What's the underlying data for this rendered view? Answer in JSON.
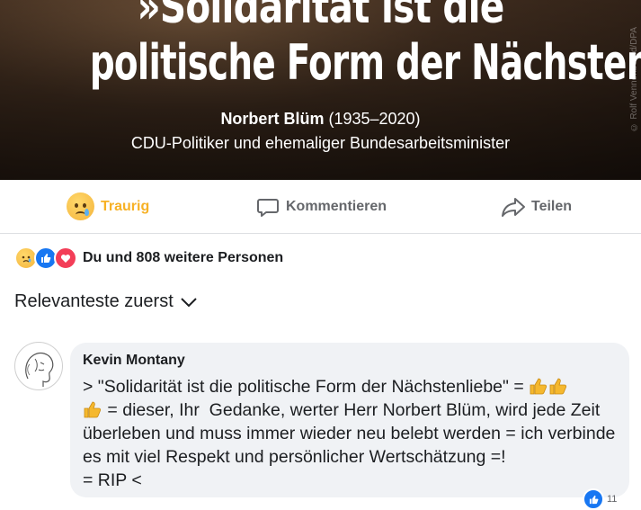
{
  "post_image": {
    "quote_line1": "»Solidarität ist die",
    "quote_line2": "politische Form der Nächstenliebe«",
    "author_name": "Norbert Blüm",
    "author_years": "(1935–2020)",
    "author_role": "CDU-Politiker und ehemaliger Bundesarbeitsminister",
    "watermark": "© Rolf Vennenbernd/DPA"
  },
  "actions": {
    "reaction_label": "Traurig",
    "comment_label": "Kommentieren",
    "share_label": "Teilen"
  },
  "reactions": {
    "summary": "Du und 808 weitere Personen",
    "icons": [
      "sad-emoji",
      "like-icon",
      "love-icon"
    ]
  },
  "sort": {
    "label": "Relevanteste zuerst"
  },
  "comment": {
    "author": "Kevin Montany",
    "text_1": "> \"Solidarität ist die politische Form der Nächstenliebe\" = ",
    "text_2": " = dieser, Ihr  Gedanke, werter Herr Norbert Blüm, wird jede Zeit überleben und muss immer wieder neu belebt werden = ich verbinde es mit viel Respekt und persönlicher Wertschätzung =!\n= RIP <",
    "like_count": "11"
  },
  "colors": {
    "accent_sad": "#f7b125",
    "like_blue": "#1877f2",
    "love_red": "#f33e58",
    "bubble_bg": "#f0f2f5"
  }
}
